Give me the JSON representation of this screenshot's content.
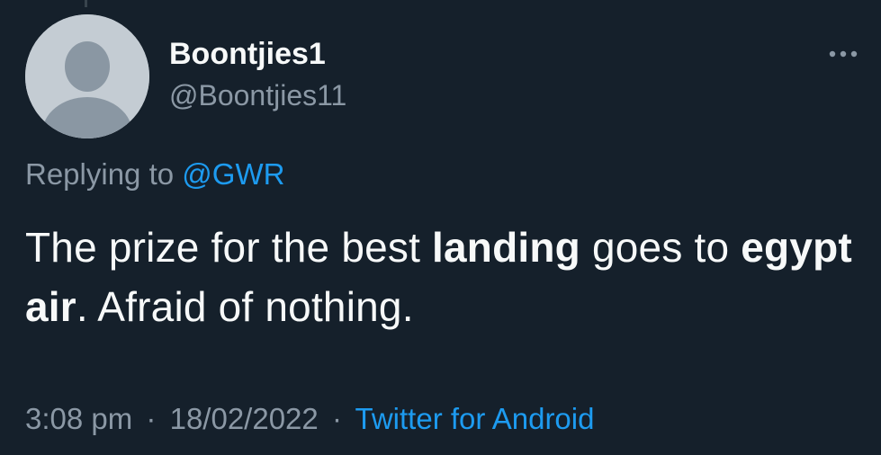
{
  "tweet": {
    "author": {
      "display_name": "Boontjies1",
      "handle": "@Boontjies11",
      "avatar_icon": "default-profile-icon"
    },
    "reply": {
      "prefix": "Replying to",
      "mention": "@GWR"
    },
    "text": {
      "part1": "The prize for the best ",
      "bold1": "landing",
      "part2": " goes to ",
      "bold2": "egypt air",
      "part3": ". Afraid of nothing."
    },
    "meta": {
      "time": "3:08 pm",
      "separator": "·",
      "date": "18/02/2022",
      "source": "Twitter for Android"
    },
    "menu_icon": "more-options-icon"
  },
  "colors": {
    "background": "#15202b",
    "text": "#f7f9f9",
    "secondary": "#8b98a5",
    "link": "#1d9bf0"
  }
}
